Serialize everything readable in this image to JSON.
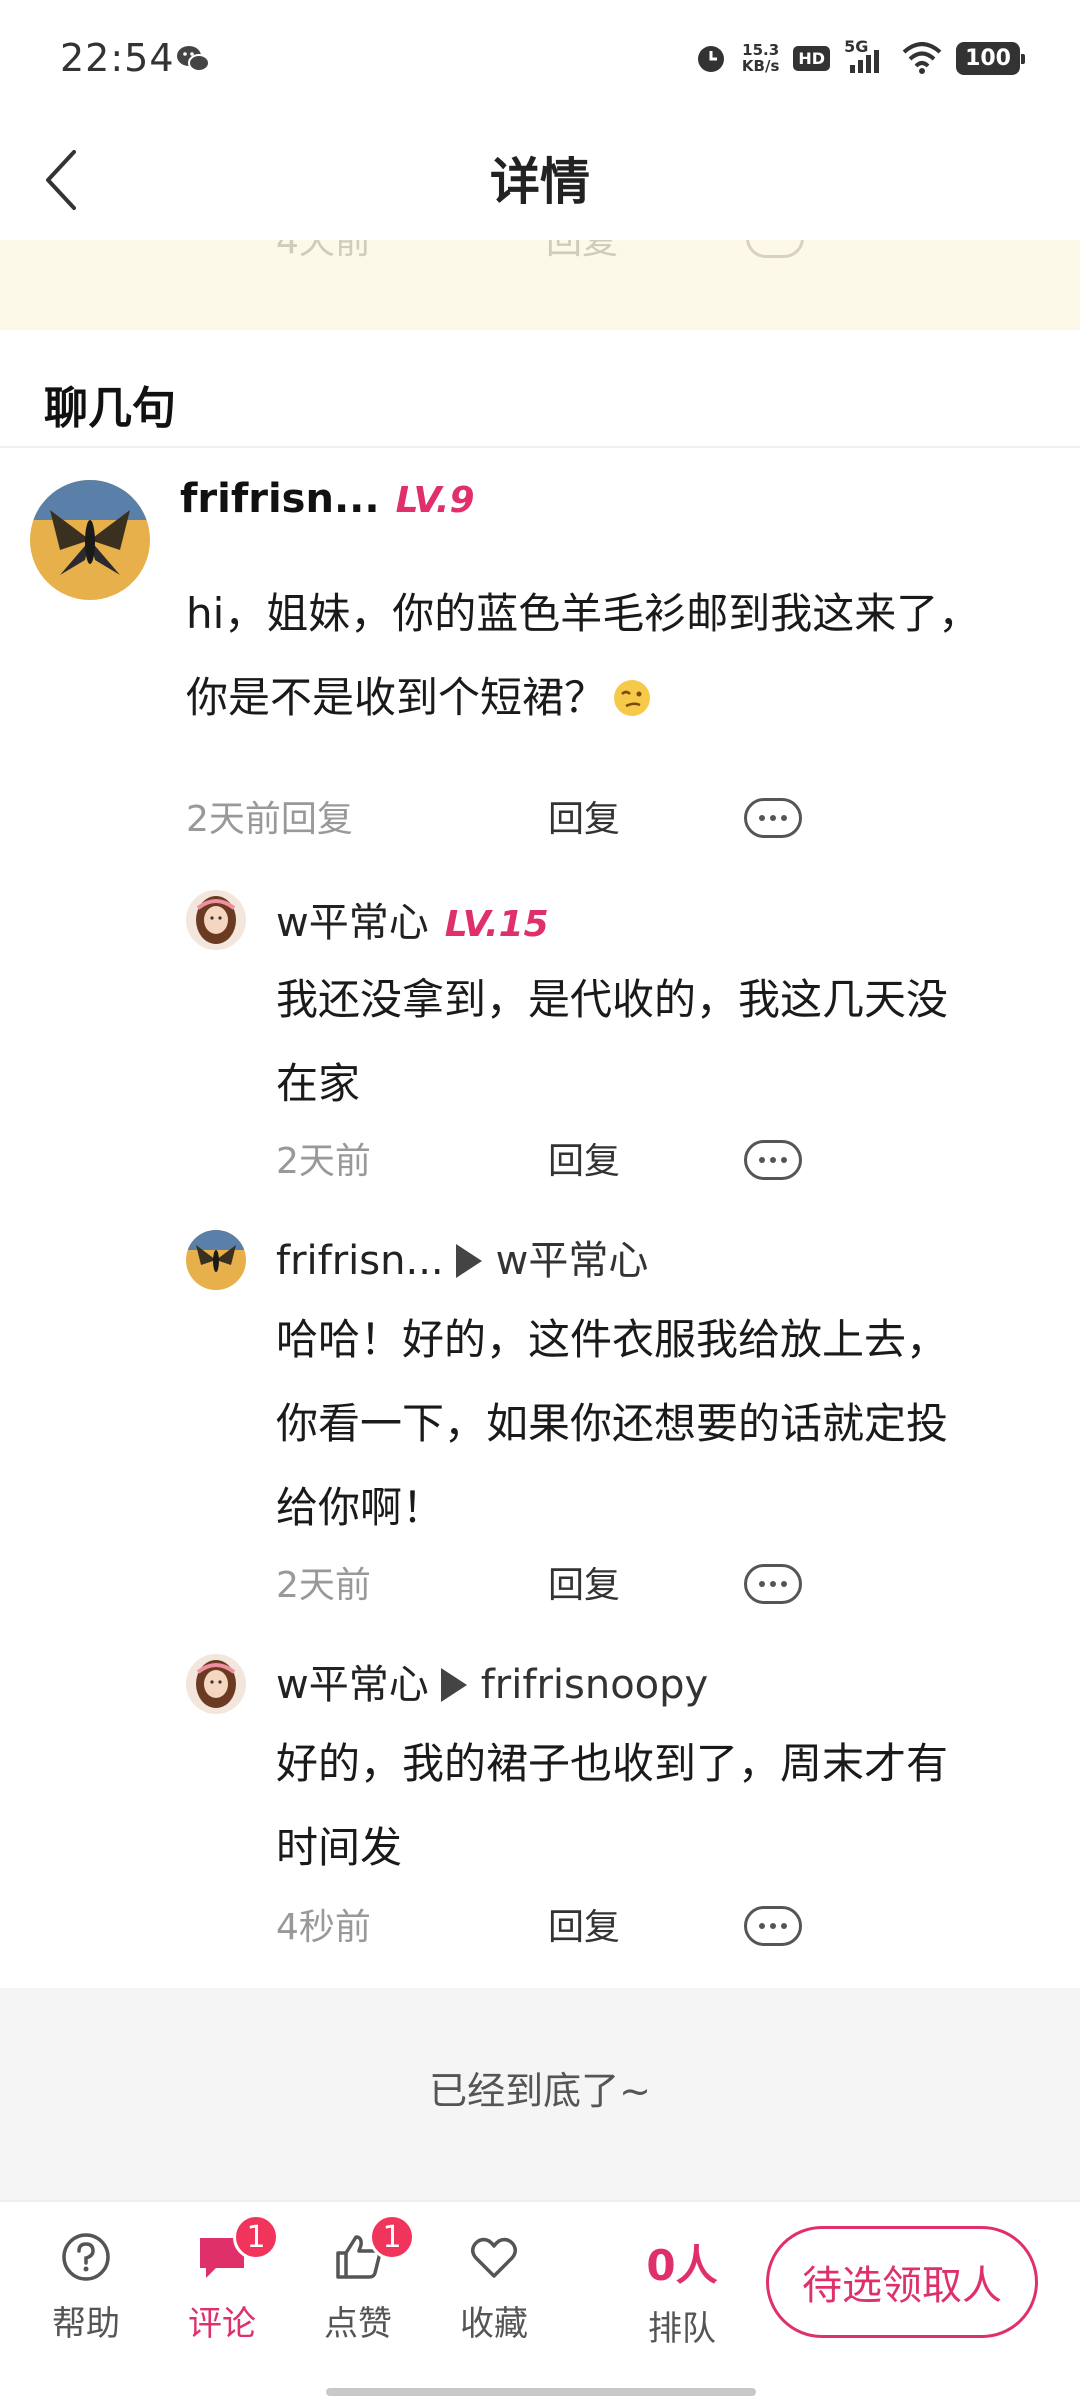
{
  "status_bar": {
    "time": "22:54",
    "net_speed_value": "15.3",
    "net_speed_unit": "KB/s",
    "hd_label": "HD",
    "network_label": "5G",
    "battery": "100"
  },
  "header": {
    "title": "详情"
  },
  "ghost_strip": {
    "time": "4天前",
    "reply": "回复"
  },
  "section": {
    "title": "聊几句"
  },
  "comments": [
    {
      "name": "frifrisn...",
      "level": "LV.9",
      "text_line1": "hi，姐妹，你的蓝色羊毛衫邮到我这来了，",
      "text_line2": "你是不是收到个短裙？",
      "time": "2天前回复",
      "reply_label": "回复"
    },
    {
      "name": "w平常心",
      "level": "LV.15",
      "text_line1": "我还没拿到，是代收的，我这几天没",
      "text_line2": "在家",
      "time": "2天前",
      "reply_label": "回复"
    },
    {
      "name": "frifrisn...",
      "reply_to": "w平常心",
      "text_line1": "哈哈！好的，这件衣服我给放上去，",
      "text_line2": "你看一下，如果你还想要的话就定投",
      "text_line3": "给你啊！",
      "time": "2天前",
      "reply_label": "回复"
    },
    {
      "name": "w平常心",
      "reply_to": "frifrisnoopy",
      "text_line1": "好的，我的裙子也收到了，周末才有",
      "text_line2": "时间发",
      "time": "4秒前",
      "reply_label": "回复"
    }
  ],
  "end_text": "已经到底了~",
  "bottom_bar": {
    "help": "帮助",
    "comment": "评论",
    "comment_badge": "1",
    "like": "点赞",
    "like_badge": "1",
    "favorite": "收藏",
    "queue_count": "0人",
    "queue_label": "排队",
    "claim_button": "待选领取人"
  },
  "colors": {
    "accent": "#e0306a",
    "badge": "#f0345b",
    "cream": "#fdf9e8",
    "end_background": "#f5f5f5"
  },
  "icons": [
    "wechat-icon",
    "alarm-icon",
    "signal-icon",
    "wifi-icon",
    "back-arrow-icon",
    "more-icon",
    "question-icon",
    "comment-icon",
    "thumbs-up-icon",
    "heart-icon",
    "emoji-icon"
  ]
}
